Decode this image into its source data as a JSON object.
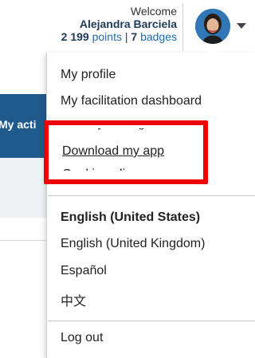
{
  "header": {
    "welcome": "Welcome",
    "user_name": "Alejandra Barciela",
    "points_value": "2 199",
    "points_label": "points",
    "separator": "|",
    "badges_value": "7",
    "badges_label": "badges"
  },
  "background": {
    "nav_label": "My acti"
  },
  "menu": {
    "items": [
      {
        "label": "My profile"
      },
      {
        "label": "My facilitation dashboard"
      },
      {
        "label": "Privacy settings"
      },
      {
        "label": "Download my app"
      },
      {
        "label": "Cookie policy"
      }
    ],
    "languages": [
      {
        "label": "English (United States)",
        "selected": true
      },
      {
        "label": "English (United Kingdom)"
      },
      {
        "label": "Español"
      },
      {
        "label": "中文"
      }
    ],
    "logout": "Log out"
  },
  "colors": {
    "highlight": "#ee0000",
    "banner": "#1f5a8c",
    "link": "#1f6bb0"
  }
}
